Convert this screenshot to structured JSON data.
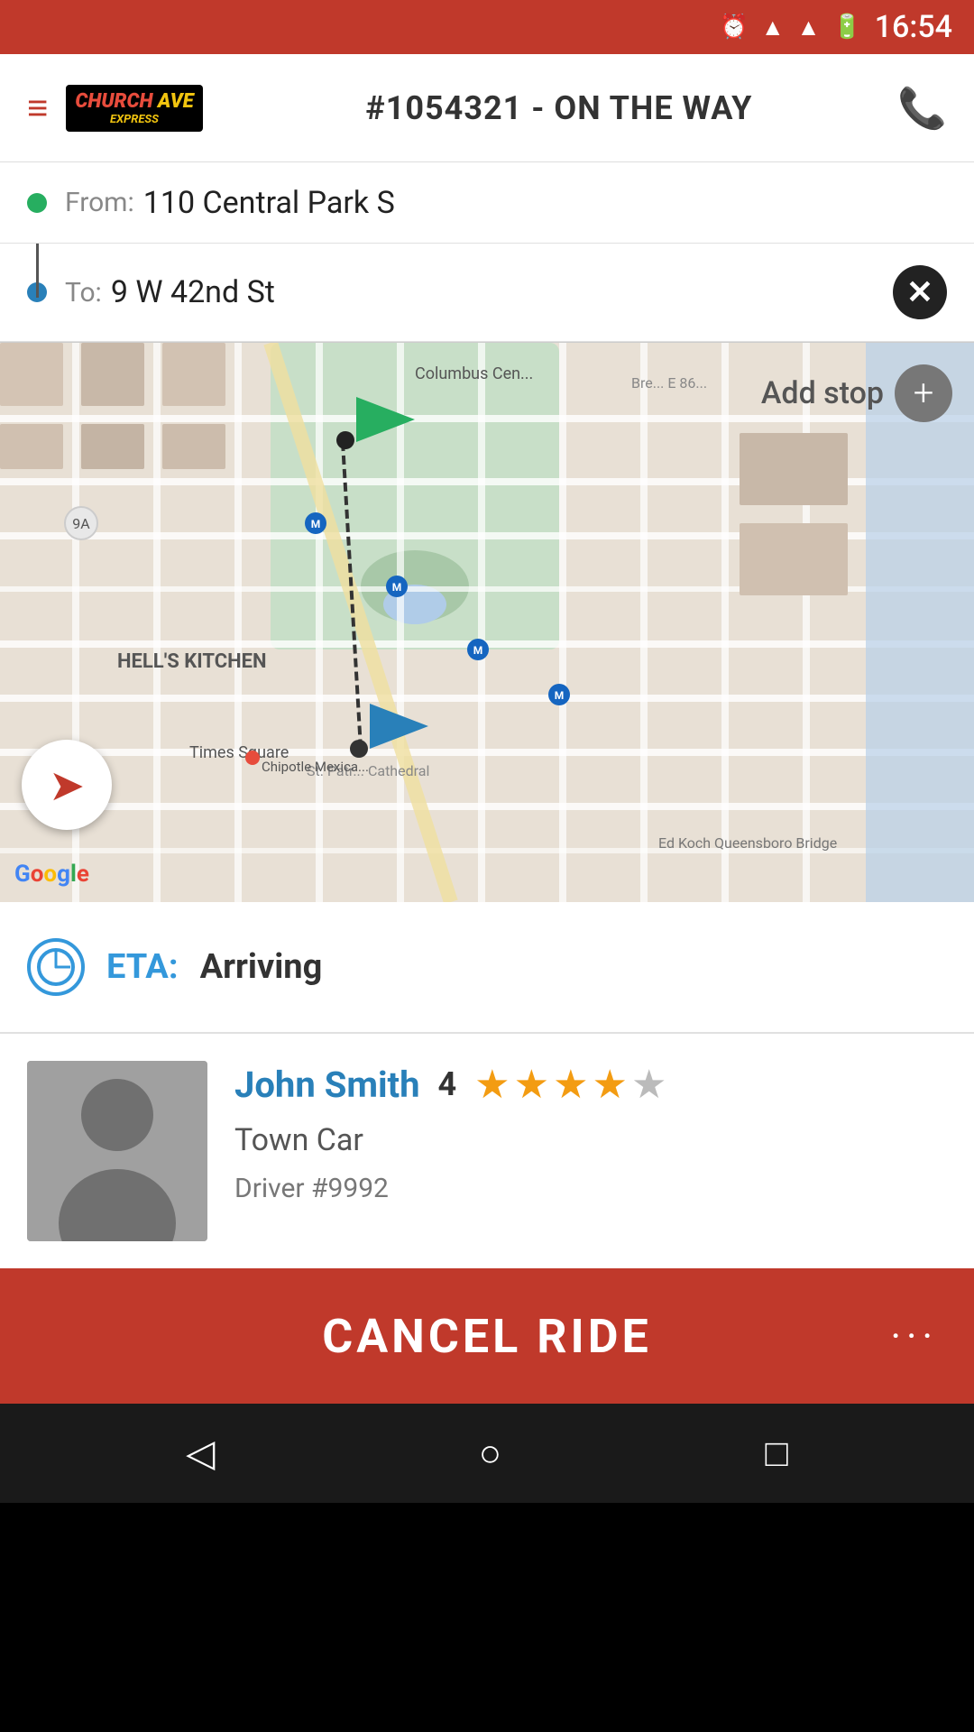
{
  "statusBar": {
    "time": "16:54",
    "icons": [
      "alarm-icon",
      "wifi-icon",
      "signal-icon",
      "battery-icon"
    ]
  },
  "header": {
    "menuLabel": "≡",
    "logoLine1Church": "CHURCH",
    "logoLine1Ave": " AVE",
    "logoLine2": "EXPRESS",
    "title": "#1054321 - ON THE WAY",
    "phoneLabel": "📞"
  },
  "route": {
    "fromLabel": "From:",
    "fromAddress": "110 Central Park S",
    "toLabel": "To:",
    "toAddress": "9 W 42nd St",
    "clearBtn": "✕"
  },
  "map": {
    "addStopLabel": "Add stop",
    "addStopIcon": "+",
    "locationIcon": "▶"
  },
  "eta": {
    "label": "ETA:",
    "value": "Arriving"
  },
  "driver": {
    "name": "John Smith",
    "rating": "4",
    "stars": [
      true,
      true,
      true,
      true,
      false
    ],
    "carType": "Town Car",
    "driverNumber": "Driver #9992"
  },
  "cancelBtn": {
    "label": "CANCEL RIDE",
    "moreLabel": "···"
  },
  "navBar": {
    "backIcon": "◁",
    "homeIcon": "○",
    "squareIcon": "□"
  }
}
